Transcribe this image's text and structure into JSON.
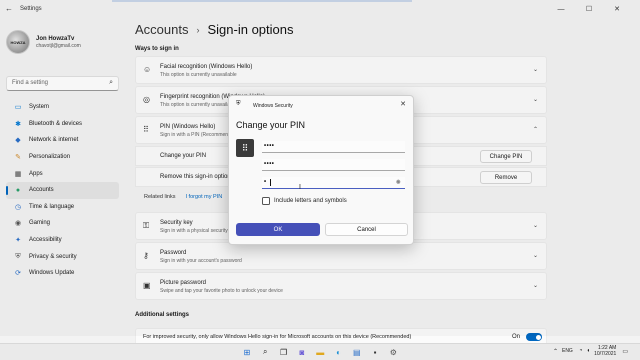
{
  "window": {
    "title": "Settings",
    "back_glyph": "←",
    "minimize": "—",
    "maximize": "☐",
    "close": "✕"
  },
  "profile": {
    "avatar_text": "HOWZA",
    "name": "Jon HowzaTv",
    "email": "chavotjl@gmail.com"
  },
  "search": {
    "placeholder": "Find a setting",
    "icon": "search-icon",
    "glyph": "⌕"
  },
  "sidebar": {
    "items": [
      {
        "label": "System",
        "glyph": "▭",
        "color": "#0078d4"
      },
      {
        "label": "Bluetooth & devices",
        "glyph": "✱",
        "color": "#0078d4"
      },
      {
        "label": "Network & internet",
        "glyph": "◆",
        "color": "#2a6fc9"
      },
      {
        "label": "Personalization",
        "glyph": "✎",
        "color": "#d08a2a"
      },
      {
        "label": "Apps",
        "glyph": "▦",
        "color": "#444444"
      },
      {
        "label": "Accounts",
        "glyph": "●",
        "color": "#2aa06b"
      },
      {
        "label": "Time & language",
        "glyph": "◷",
        "color": "#2a6fc9"
      },
      {
        "label": "Gaming",
        "glyph": "◉",
        "color": "#555555"
      },
      {
        "label": "Accessibility",
        "glyph": "✦",
        "color": "#2a6fc9"
      },
      {
        "label": "Privacy & security",
        "glyph": "⛨",
        "color": "#555555"
      },
      {
        "label": "Windows Update",
        "glyph": "⟳",
        "color": "#2a6fc9"
      }
    ],
    "active_index": 5
  },
  "breadcrumb": {
    "parent": "Accounts",
    "separator": "›",
    "current": "Sign-in options"
  },
  "ways_title": "Ways to sign in",
  "cards": {
    "facial": {
      "title": "Facial recognition (Windows Hello)",
      "subtitle": "This option is currently unavailable",
      "glyph": "☺"
    },
    "fingerprint": {
      "title": "Fingerprint recognition (Windows Hello)",
      "subtitle": "This option is currently unavailable",
      "glyph": "◎"
    },
    "pin": {
      "title": "PIN (Windows Hello)",
      "subtitle": "Sign in with a PIN (Recommended)",
      "glyph": "⠿"
    },
    "security_key": {
      "title": "Security key",
      "subtitle": "Sign in with a physical security key",
      "glyph": "⚿"
    },
    "password": {
      "title": "Password",
      "subtitle": "Sign in with your account's password",
      "glyph": "⚷"
    },
    "picture_password": {
      "title": "Picture password",
      "subtitle": "Swipe and tap your favorite photo to unlock your device",
      "glyph": "▣"
    }
  },
  "pin_rows": {
    "change": {
      "label": "Change your PIN",
      "button": "Change PIN"
    },
    "remove": {
      "label": "Remove this sign-in option",
      "button": "Remove"
    }
  },
  "related": {
    "label": "Related links",
    "link": "I forgot my PIN"
  },
  "additional": {
    "title": "Additional settings",
    "text": "For improved security, only allow Windows Hello sign-in for Microsoft accounts on this device (Recommended)",
    "toggle_label": "On"
  },
  "dialog": {
    "app": "Windows Security",
    "title": "Change your PIN",
    "fields": [
      "••••",
      "••••",
      "•"
    ],
    "checkbox_label": "Include letters and symbols",
    "ok": "OK",
    "cancel": "Cancel"
  },
  "taskbar": {
    "icons": [
      {
        "name": "start",
        "glyph": "⊞",
        "color": "#1f6fd1"
      },
      {
        "name": "search",
        "glyph": "⌕",
        "color": "#222222"
      },
      {
        "name": "task-view",
        "glyph": "❐",
        "color": "#222222"
      },
      {
        "name": "chat",
        "glyph": "◙",
        "color": "#6b5bd6"
      },
      {
        "name": "explorer",
        "glyph": "▬",
        "color": "#e0a81f"
      },
      {
        "name": "edge",
        "glyph": "◐",
        "color": "#1a8fd4"
      },
      {
        "name": "store",
        "glyph": "▤",
        "color": "#2a6fc9"
      },
      {
        "name": "terminal",
        "glyph": "▪",
        "color": "#333333"
      },
      {
        "name": "settings",
        "glyph": "⚙",
        "color": "#555555"
      }
    ],
    "lang": "ENG",
    "time": "1:22 AM",
    "date": "10/7/2021"
  }
}
